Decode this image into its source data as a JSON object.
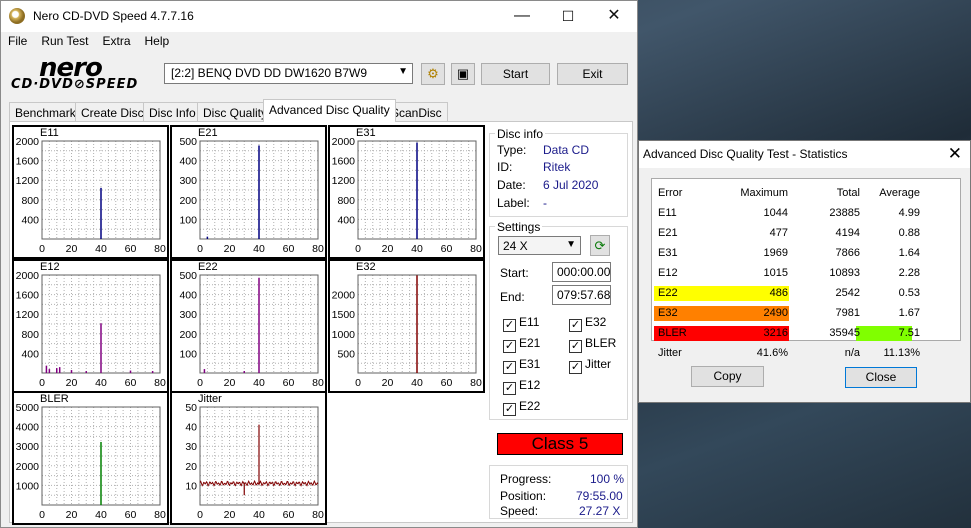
{
  "window": {
    "title": "Nero CD-DVD Speed 4.7.7.16",
    "minimize": "—",
    "maximize": "☐",
    "close": "✕"
  },
  "menu": [
    "File",
    "Run Test",
    "Extra",
    "Help"
  ],
  "logo": {
    "top": "nero",
    "bottom": "CD·DVD⊘SPEED"
  },
  "drive": {
    "selected": "[2:2]   BENQ DVD DD DW1620 B7W9"
  },
  "buttons": {
    "start": "Start",
    "exit": "Exit"
  },
  "tabs": [
    "Benchmark",
    "Create Disc",
    "Disc Info",
    "Disc Quality",
    "Advanced Disc Quality",
    "ScanDisc"
  ],
  "active_tab": 4,
  "disc_info": {
    "heading": "Disc info",
    "rows": [
      {
        "label": "Type:",
        "value": "Data CD"
      },
      {
        "label": "ID:",
        "value": "Ritek"
      },
      {
        "label": "Date:",
        "value": "6 Jul 2020"
      },
      {
        "label": "Label:",
        "value": "-"
      }
    ]
  },
  "settings": {
    "heading": "Settings",
    "speed": "24 X",
    "start_label": "Start:",
    "start_value": "000:00.00",
    "end_label": "End:",
    "end_value": "079:57.68",
    "checkboxes_left": [
      "E11",
      "E21",
      "E31",
      "E12",
      "E22"
    ],
    "checkboxes_right": [
      "E32",
      "BLER",
      "Jitter"
    ]
  },
  "class_label": "Class 5",
  "progress": {
    "rows": [
      {
        "label": "Progress:",
        "value": "100 %"
      },
      {
        "label": "Position:",
        "value": "79:55.00"
      },
      {
        "label": "Speed:",
        "value": "27.27 X"
      }
    ]
  },
  "chart_data": [
    {
      "type": "bar",
      "title": "E11",
      "xlim": [
        0,
        80
      ],
      "ylim": [
        0,
        2000
      ],
      "yticks": [
        400,
        800,
        1200,
        1600,
        2000
      ],
      "xticks": [
        0,
        20,
        40,
        60,
        80
      ],
      "color": "#000080",
      "spikes": [
        [
          40,
          1044
        ]
      ]
    },
    {
      "type": "bar",
      "title": "E21",
      "xlim": [
        0,
        80
      ],
      "ylim": [
        0,
        500
      ],
      "yticks": [
        100,
        200,
        300,
        400,
        500
      ],
      "xticks": [
        0,
        20,
        40,
        60,
        80
      ],
      "color": "#000080",
      "spikes": [
        [
          40,
          477
        ],
        [
          5,
          12
        ]
      ]
    },
    {
      "type": "bar",
      "title": "E31",
      "xlim": [
        0,
        80
      ],
      "ylim": [
        0,
        2000
      ],
      "yticks": [
        400,
        800,
        1200,
        1600,
        2000
      ],
      "xticks": [
        0,
        20,
        40,
        60,
        80
      ],
      "color": "#000080",
      "spikes": [
        [
          40,
          1969
        ]
      ]
    },
    {
      "type": "bar",
      "title": "E12",
      "xlim": [
        0,
        80
      ],
      "ylim": [
        0,
        2000
      ],
      "yticks": [
        400,
        800,
        1200,
        1600,
        2000
      ],
      "xticks": [
        0,
        20,
        40,
        60,
        80
      ],
      "color": "#800080",
      "spikes": [
        [
          3,
          150
        ],
        [
          5,
          80
        ],
        [
          10,
          100
        ],
        [
          12,
          120
        ],
        [
          20,
          60
        ],
        [
          30,
          40
        ],
        [
          40,
          1015
        ],
        [
          60,
          50
        ],
        [
          75,
          40
        ]
      ]
    },
    {
      "type": "bar",
      "title": "E22",
      "xlim": [
        0,
        80
      ],
      "ylim": [
        0,
        500
      ],
      "yticks": [
        100,
        200,
        300,
        400,
        500
      ],
      "xticks": [
        0,
        20,
        40,
        60,
        80
      ],
      "color": "#800080",
      "spikes": [
        [
          40,
          486
        ],
        [
          3,
          20
        ],
        [
          30,
          10
        ]
      ]
    },
    {
      "type": "bar",
      "title": "E32",
      "xlim": [
        0,
        80
      ],
      "ylim": [
        0,
        2500
      ],
      "yticks": [
        500,
        1000,
        1500,
        2000
      ],
      "xticks": [
        0,
        20,
        40,
        60,
        80
      ],
      "color": "#800000",
      "spikes": [
        [
          40,
          2490
        ]
      ]
    },
    {
      "type": "bar",
      "title": "BLER",
      "xlim": [
        0,
        80
      ],
      "ylim": [
        0,
        5000
      ],
      "yticks": [
        1000,
        2000,
        3000,
        4000,
        5000
      ],
      "xticks": [
        0,
        20,
        40,
        60,
        80
      ],
      "color": "#008000",
      "spikes": [
        [
          40,
          3216
        ]
      ]
    },
    {
      "type": "line",
      "title": "Jitter",
      "xlim": [
        0,
        80
      ],
      "ylim": [
        0,
        50
      ],
      "yticks": [
        10,
        20,
        30,
        40,
        50
      ],
      "xticks": [
        0,
        20,
        40,
        60,
        80
      ],
      "color": "#800000",
      "baseline": 11,
      "spikes": [
        [
          30,
          5
        ],
        [
          40,
          41
        ]
      ]
    }
  ],
  "stats": {
    "title": "Advanced Disc Quality Test - Statistics",
    "headers": [
      "Error",
      "Maximum",
      "Total",
      "Average"
    ],
    "rows": [
      [
        "E11",
        "1044",
        "23885",
        "4.99"
      ],
      [
        "E21",
        "477",
        "4194",
        "0.88"
      ],
      [
        "E31",
        "1969",
        "7866",
        "1.64"
      ],
      [
        "E12",
        "1015",
        "10893",
        "2.28"
      ],
      [
        "E22",
        "486",
        "2542",
        "0.53"
      ],
      [
        "E32",
        "2490",
        "7981",
        "1.67"
      ],
      [
        "BLER",
        "3216",
        "35945",
        "7.51"
      ],
      [
        "Jitter",
        "41.6%",
        "n/a",
        "11.13%"
      ]
    ],
    "highlight_colors": {
      "E22": "#ffff00",
      "E32": "#ff8000",
      "BLER": "#ff0000",
      "avg_bler": "#80ff00"
    },
    "copy_label": "Copy",
    "close_label": "Close"
  }
}
